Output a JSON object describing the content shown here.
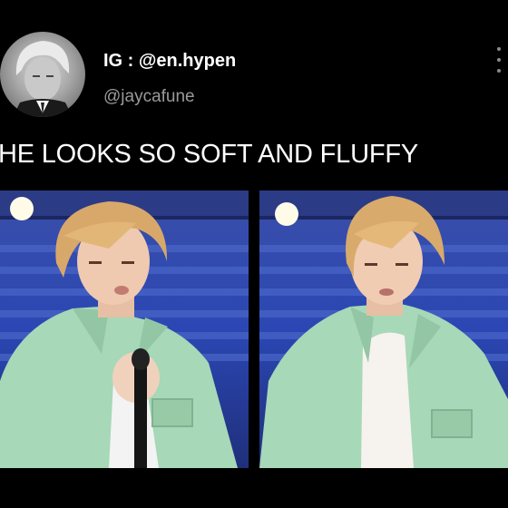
{
  "tweet": {
    "display_name": "IG : @en.hypen",
    "handle": "@jaycafune",
    "text": "HE LOOKS SO SOFT AND FLUFFY"
  },
  "icons": {
    "more": "more-vertical-icon",
    "avatar": "avatar"
  },
  "colors": {
    "background": "#000000",
    "text_primary": "#ffffff",
    "text_secondary": "#9a9a9a",
    "jacket": "#a7d8b8",
    "stadium_seats": "#2a4bb0"
  }
}
